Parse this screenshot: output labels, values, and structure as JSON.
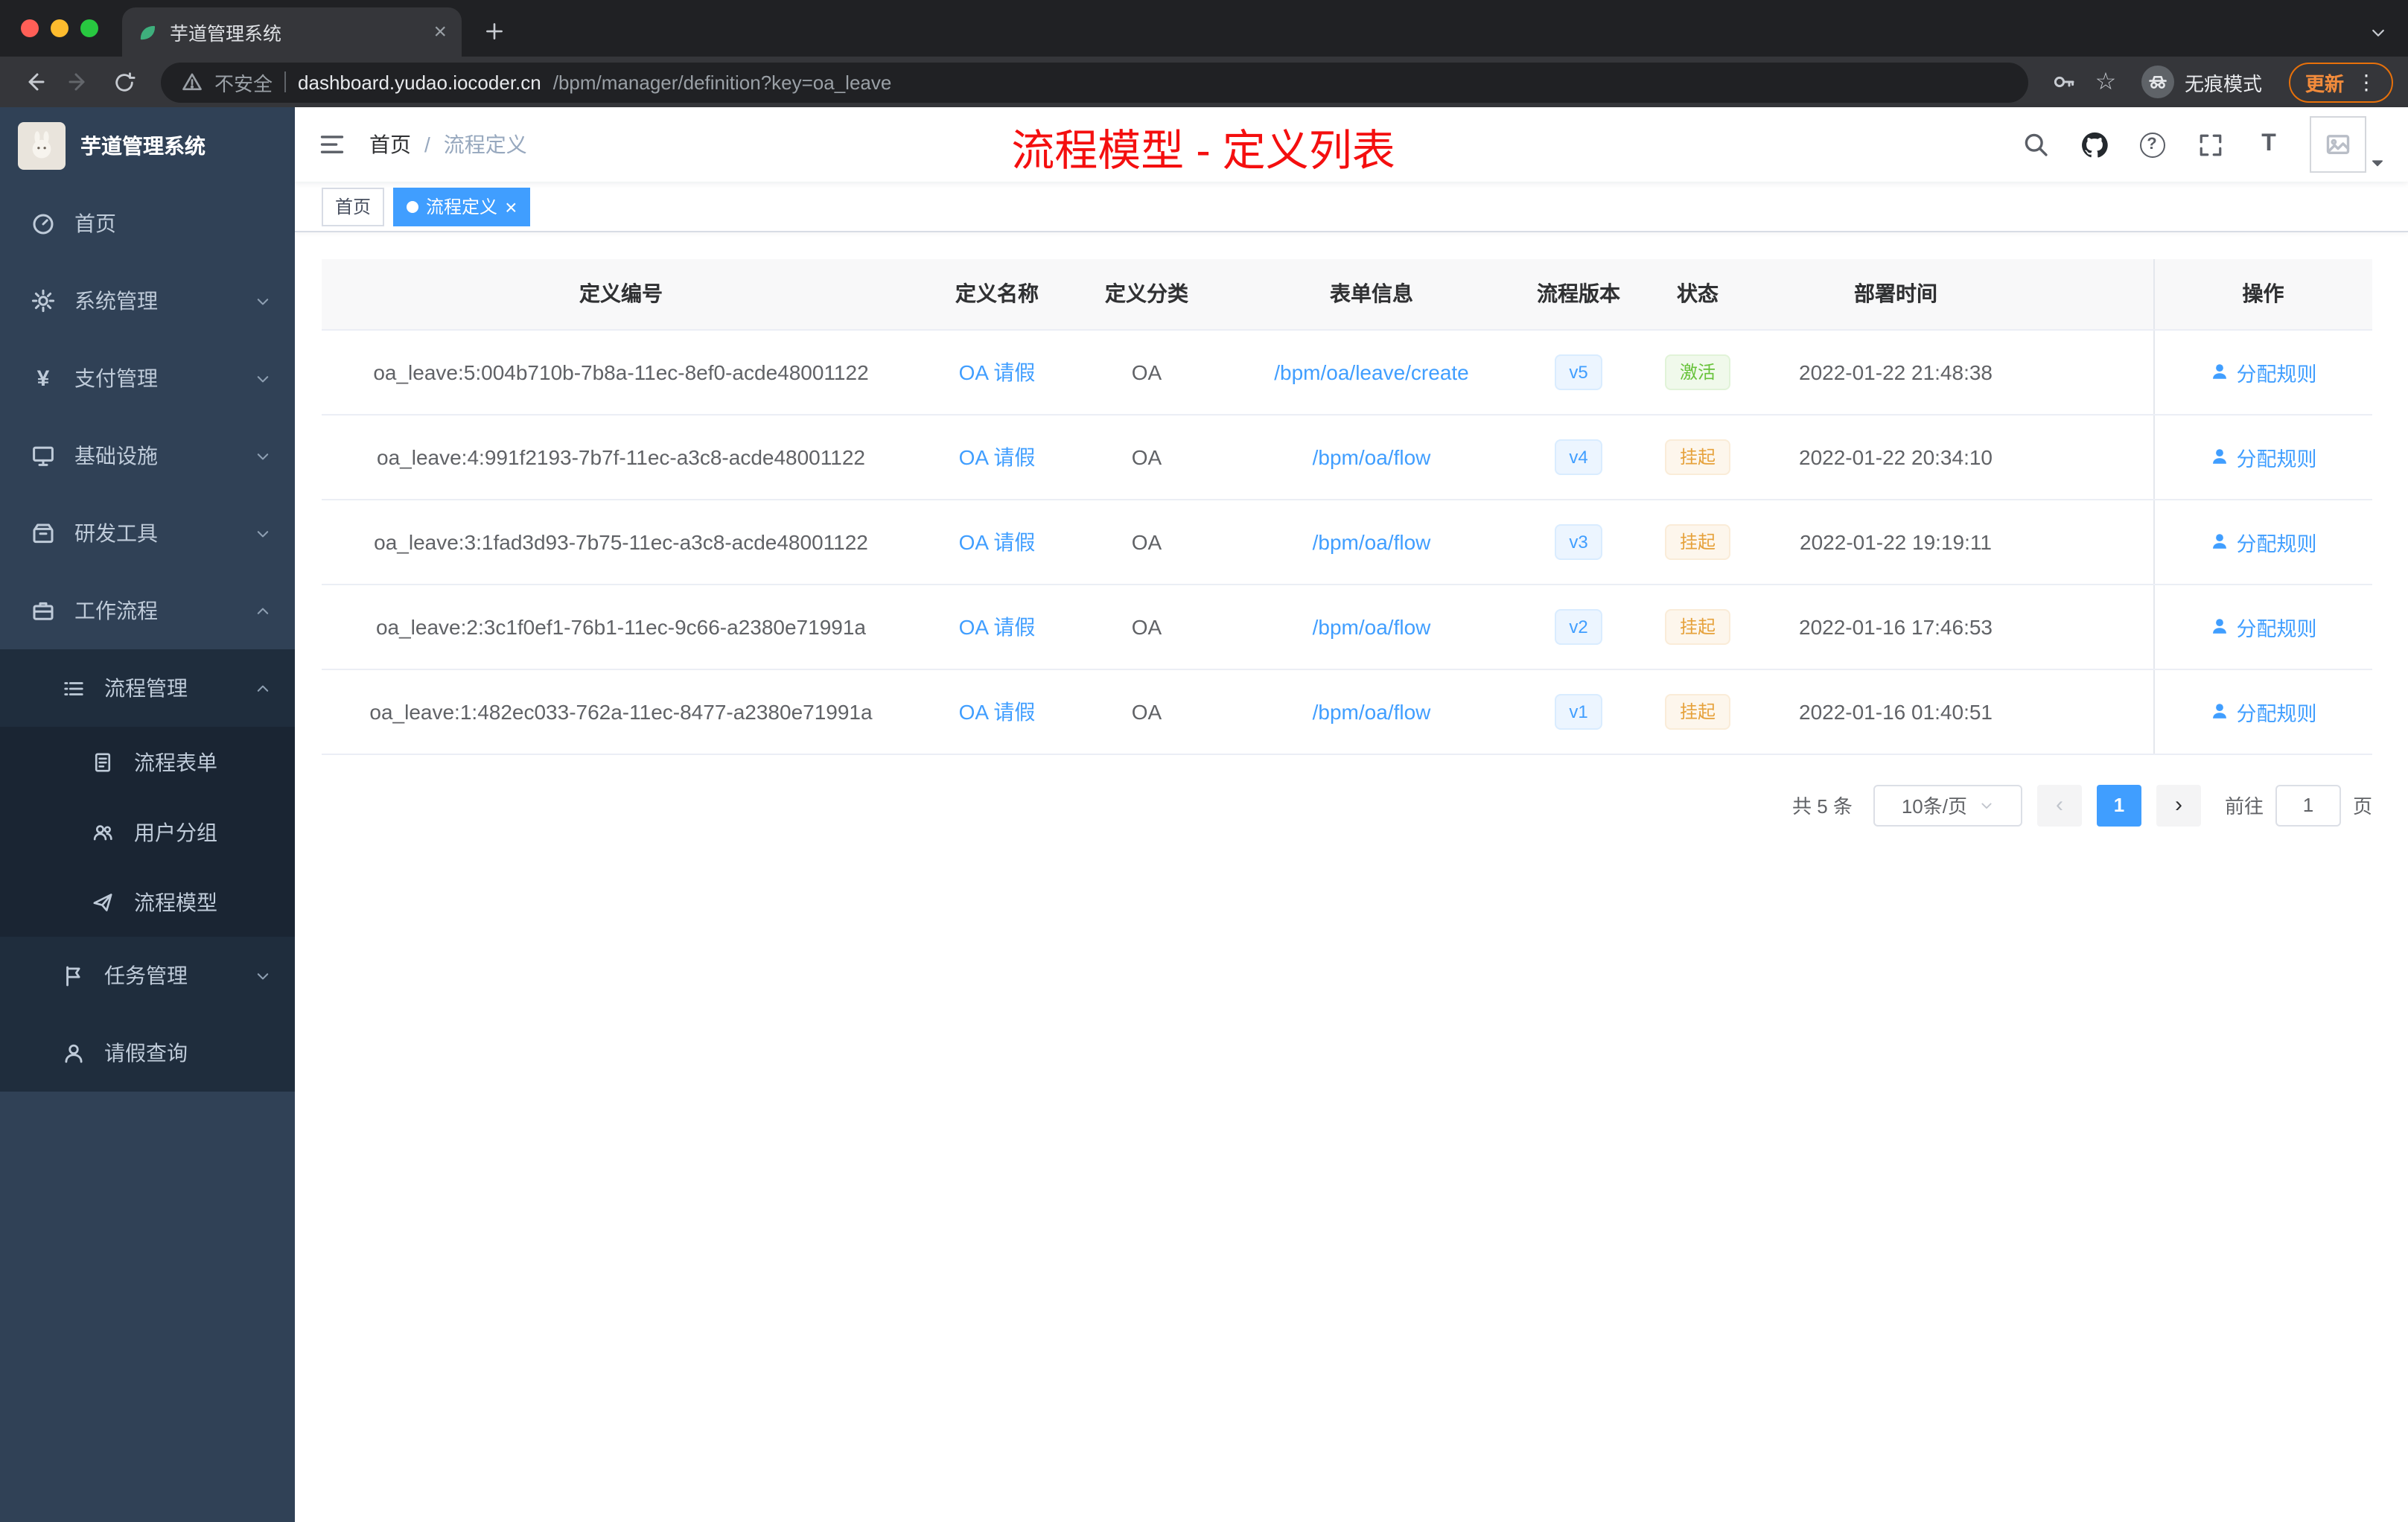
{
  "colors": {
    "primary": "#409eff",
    "page_title_red": "#f40f0f",
    "success": "#67c23a",
    "warning": "#e6a23c",
    "sidebar_bg": "#304156",
    "sidebar_sub_bg": "#1f2d3d"
  },
  "browser": {
    "tab_title": "芋道管理系统",
    "security_label": "不安全",
    "url_host": "dashboard.yudao.iocoder.cn",
    "url_path": "/bpm/manager/definition?key=oa_leave",
    "incognito_label": "无痕模式",
    "update_label": "更新"
  },
  "icons": {
    "question_glyph": "?",
    "star_glyph": "☆",
    "kebab_glyph": "⋮",
    "close_glyph": "×",
    "yen_glyph": "¥",
    "prev_glyph": "‹",
    "next_glyph": "›",
    "font_size_glyph": "T",
    "breadcrumb_separator": "/"
  },
  "sidebar": {
    "logo_title": "芋道管理系统",
    "items": [
      {
        "label": "首页",
        "icon": "dashboard-icon"
      },
      {
        "label": "系统管理",
        "icon": "gear-icon"
      },
      {
        "label": "支付管理",
        "icon": "yen-icon"
      },
      {
        "label": "基础设施",
        "icon": "monitor-icon"
      },
      {
        "label": "研发工具",
        "icon": "toolbox-icon"
      },
      {
        "label": "工作流程",
        "icon": "briefcase-icon"
      }
    ],
    "workflow_submenu": [
      {
        "label": "流程管理",
        "icon": "list-icon",
        "expanded": true
      },
      {
        "label": "任务管理",
        "icon": "flag-icon"
      },
      {
        "label": "请假查询",
        "icon": "person-icon"
      }
    ],
    "process_submenu": [
      {
        "label": "流程表单",
        "icon": "document-icon"
      },
      {
        "label": "用户分组",
        "icon": "users-icon"
      },
      {
        "label": "流程模型",
        "icon": "paper-plane-icon"
      }
    ]
  },
  "header": {
    "breadcrumb_home": "首页",
    "breadcrumb_current": "流程定义",
    "page_title": "流程模型 - 定义列表"
  },
  "tags": {
    "home": "首页",
    "active": "流程定义"
  },
  "table": {
    "columns": [
      "定义编号",
      "定义名称",
      "定义分类",
      "表单信息",
      "流程版本",
      "状态",
      "部署时间",
      "操作"
    ],
    "rows": [
      {
        "id": "oa_leave:5:004b710b-7b8a-11ec-8ef0-acde48001122",
        "name": "OA 请假",
        "category": "OA",
        "form": "/bpm/oa/leave/create",
        "version": "v5",
        "status": "激活",
        "status_type": "success",
        "time": "2022-01-22 21:48:38",
        "action": "分配规则"
      },
      {
        "id": "oa_leave:4:991f2193-7b7f-11ec-a3c8-acde48001122",
        "name": "OA 请假",
        "category": "OA",
        "form": "/bpm/oa/flow",
        "version": "v4",
        "status": "挂起",
        "status_type": "warning",
        "time": "2022-01-22 20:34:10",
        "action": "分配规则"
      },
      {
        "id": "oa_leave:3:1fad3d93-7b75-11ec-a3c8-acde48001122",
        "name": "OA 请假",
        "category": "OA",
        "form": "/bpm/oa/flow",
        "version": "v3",
        "status": "挂起",
        "status_type": "warning",
        "time": "2022-01-22 19:19:11",
        "action": "分配规则"
      },
      {
        "id": "oa_leave:2:3c1f0ef1-76b1-11ec-9c66-a2380e71991a",
        "name": "OA 请假",
        "category": "OA",
        "form": "/bpm/oa/flow",
        "version": "v2",
        "status": "挂起",
        "status_type": "warning",
        "time": "2022-01-16 17:46:53",
        "action": "分配规则"
      },
      {
        "id": "oa_leave:1:482ec033-762a-11ec-8477-a2380e71991a",
        "name": "OA 请假",
        "category": "OA",
        "form": "/bpm/oa/flow",
        "version": "v1",
        "status": "挂起",
        "status_type": "warning",
        "time": "2022-01-16 01:40:51",
        "action": "分配规则"
      }
    ]
  },
  "pagination": {
    "total": "共 5 条",
    "page_size": "10条/页",
    "current_page": "1",
    "goto_label": "前往",
    "goto_value": "1",
    "page_unit": "页"
  }
}
